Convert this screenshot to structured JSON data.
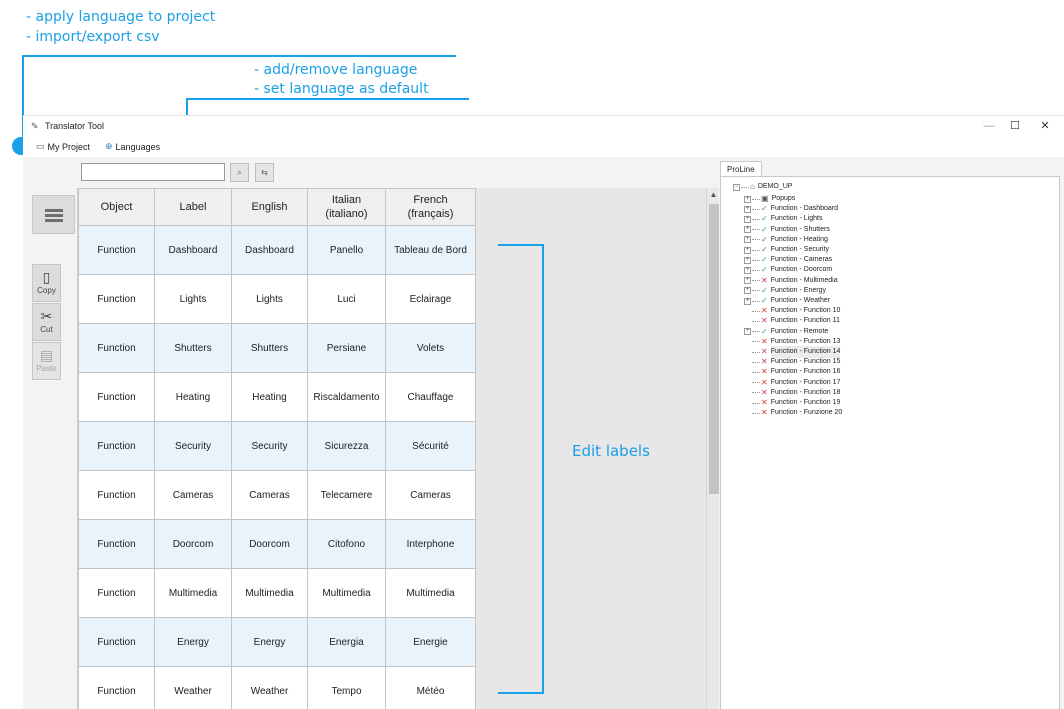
{
  "annotations": {
    "project_note_1": "- apply language to project",
    "project_note_2": "- import/export csv",
    "language_note_1": "- add/remove language",
    "language_note_2": "- set language as default",
    "edit_labels": "Edit labels",
    "accent_color": "#1aa0e6"
  },
  "window": {
    "title": "Translator Tool",
    "minimize_glyph": "—",
    "maximize_glyph": "☐",
    "close_glyph": "✕"
  },
  "menu": {
    "my_project": "My Project",
    "languages": "Languages"
  },
  "toolbar": {
    "search_value": "",
    "btn1_icon": "find-icon",
    "btn2_icon": "replace-icon"
  },
  "side_buttons": {
    "copy": "Copy",
    "cut": "Cut",
    "paste": "Paste",
    "paste_enabled": false
  },
  "grid": {
    "columns": [
      {
        "line1": "Object",
        "line2": ""
      },
      {
        "line1": "Label",
        "line2": ""
      },
      {
        "line1": "English",
        "line2": ""
      },
      {
        "line1": "Italian",
        "line2": "(italiano)"
      },
      {
        "line1": "French",
        "line2": "(français)"
      }
    ],
    "rows": [
      [
        "Function",
        "Dashboard",
        "Dashboard",
        "Panello",
        "Tableau de Bord"
      ],
      [
        "Function",
        "Lights",
        "Lights",
        "Luci",
        "Eclairage"
      ],
      [
        "Function",
        "Shutters",
        "Shutters",
        "Persiane",
        "Volets"
      ],
      [
        "Function",
        "Heating",
        "Heating",
        "Riscaldamento",
        "Chauffage"
      ],
      [
        "Function",
        "Security",
        "Security",
        "Sicurezza",
        "Sécurité"
      ],
      [
        "Function",
        "Cameras",
        "Cameras",
        "Telecamere",
        "Cameras"
      ],
      [
        "Function",
        "Doorcom",
        "Doorcom",
        "Citofono",
        "Interphone"
      ],
      [
        "Function",
        "Multimedia",
        "Multimedia",
        "Multimedia",
        "Multimedia"
      ],
      [
        "Function",
        "Energy",
        "Energy",
        "Energia",
        "Energie"
      ],
      [
        "Function",
        "Weather",
        "Weather",
        "Tempo",
        "Météo"
      ]
    ]
  },
  "panel": {
    "tab": "ProLine",
    "root": "DEMO_UP",
    "nodes": [
      {
        "label": "Popups",
        "status": "folder",
        "expandable": true
      },
      {
        "label": "Function - Dashboard",
        "status": "ok",
        "expandable": true
      },
      {
        "label": "Function - Lights",
        "status": "ok",
        "expandable": true
      },
      {
        "label": "Function - Shutters",
        "status": "ok",
        "expandable": true
      },
      {
        "label": "Function - Heating",
        "status": "ok",
        "expandable": true
      },
      {
        "label": "Function - Security",
        "status": "ok",
        "expandable": true
      },
      {
        "label": "Function - Cameras",
        "status": "ok",
        "expandable": true
      },
      {
        "label": "Function - Doorcom",
        "status": "ok",
        "expandable": true
      },
      {
        "label": "Function - Multimedia",
        "status": "missing",
        "expandable": true
      },
      {
        "label": "Function - Energy",
        "status": "ok",
        "expandable": true
      },
      {
        "label": "Function - Weather",
        "status": "ok",
        "expandable": true
      },
      {
        "label": "Function - Function 10",
        "status": "missing",
        "expandable": false
      },
      {
        "label": "Function - Function 11",
        "status": "missing",
        "expandable": false
      },
      {
        "label": "Function - Remote",
        "status": "ok",
        "expandable": true
      },
      {
        "label": "Function - Function 13",
        "status": "missing",
        "expandable": false
      },
      {
        "label": "Function - Function 14",
        "status": "missing",
        "expandable": false,
        "selected": true
      },
      {
        "label": "Function - Function 15",
        "status": "missing",
        "expandable": false
      },
      {
        "label": "Function - Function 16",
        "status": "missing",
        "expandable": false
      },
      {
        "label": "Function - Function 17",
        "status": "missing",
        "expandable": false
      },
      {
        "label": "Function - Function 18",
        "status": "missing",
        "expandable": false
      },
      {
        "label": "Function - Function 19",
        "status": "missing",
        "expandable": false
      },
      {
        "label": "Function - Funzione 20",
        "status": "missing",
        "expandable": false
      }
    ]
  }
}
